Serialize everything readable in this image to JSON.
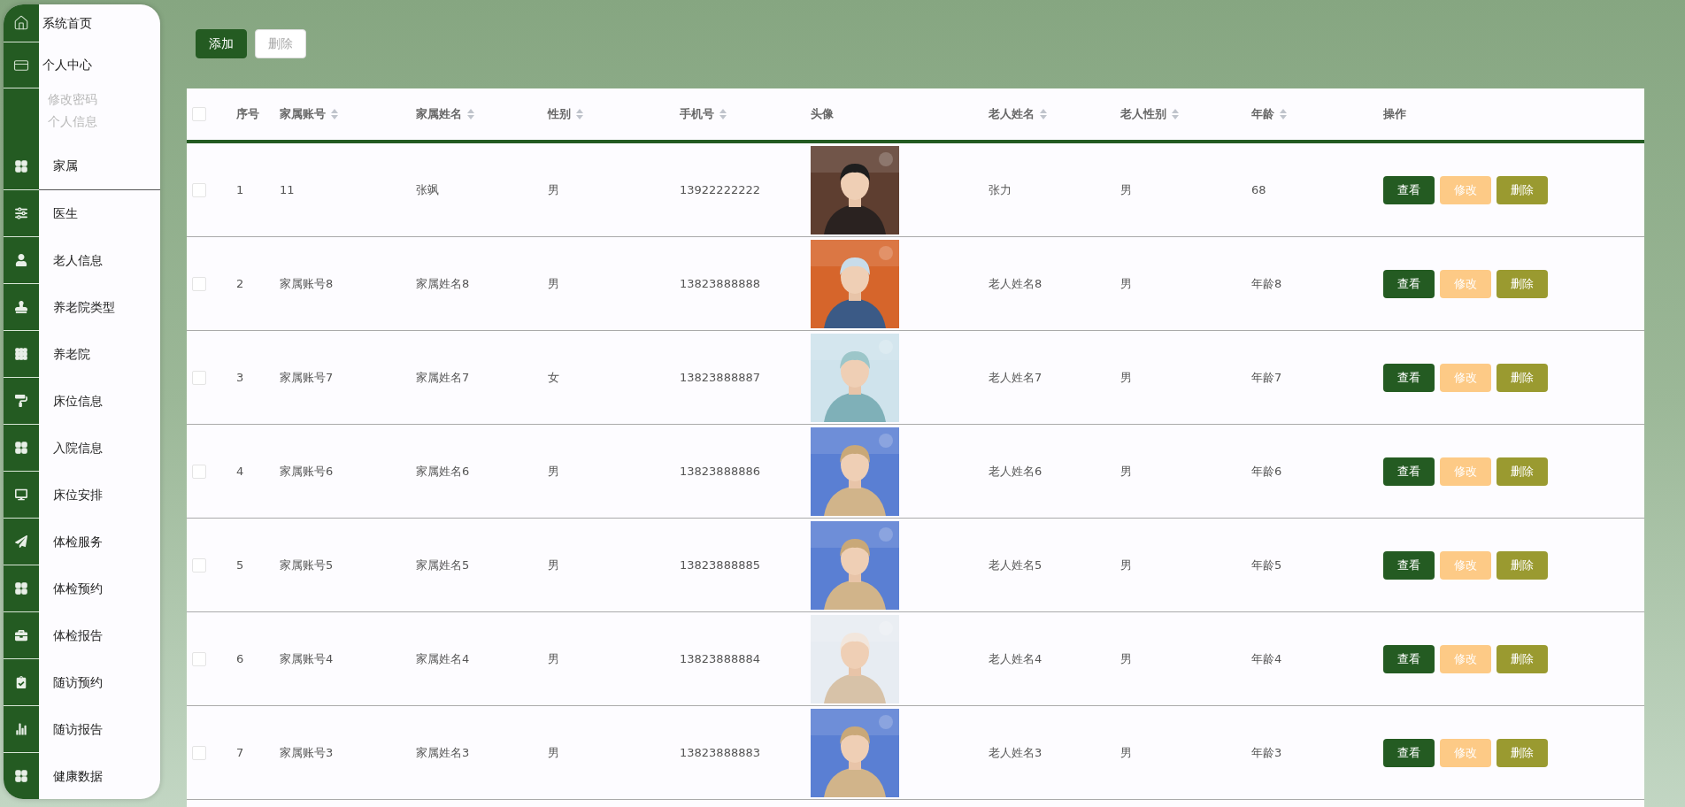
{
  "sidebar": {
    "items": [
      {
        "label": "系统首页",
        "selected": false
      },
      {
        "label": "个人中心",
        "selected": false,
        "expanded": true,
        "children": [
          {
            "label": "修改密码"
          },
          {
            "label": "个人信息"
          }
        ]
      },
      {
        "label": "家属",
        "selected": true
      },
      {
        "label": "医生",
        "selected": false
      },
      {
        "label": "老人信息",
        "selected": false
      },
      {
        "label": "养老院类型",
        "selected": false
      },
      {
        "label": "养老院",
        "selected": false
      },
      {
        "label": "床位信息",
        "selected": false
      },
      {
        "label": "入院信息",
        "selected": false
      },
      {
        "label": "床位安排",
        "selected": false
      },
      {
        "label": "体检服务",
        "selected": false
      },
      {
        "label": "体检预约",
        "selected": false
      },
      {
        "label": "体检报告",
        "selected": false
      },
      {
        "label": "随访预约",
        "selected": false
      },
      {
        "label": "随访报告",
        "selected": false
      },
      {
        "label": "健康数据",
        "selected": false
      }
    ]
  },
  "toolbar": [
    {
      "label": "添加",
      "disabled": false
    },
    {
      "label": "删除",
      "disabled": true
    }
  ],
  "table": {
    "select_all": {
      "checked": false
    },
    "columns": [
      {
        "label": "序号",
        "sortable": false
      },
      {
        "label": "家属账号",
        "sortable": true
      },
      {
        "label": "家属姓名",
        "sortable": true
      },
      {
        "label": "性别",
        "sortable": true
      },
      {
        "label": "手机号",
        "sortable": true
      },
      {
        "label": "头像",
        "sortable": false
      },
      {
        "label": "老人姓名",
        "sortable": true
      },
      {
        "label": "老人性别",
        "sortable": true
      },
      {
        "label": "年龄",
        "sortable": true
      },
      {
        "label": "操作",
        "sortable": false
      }
    ],
    "rows": [
      {
        "checked": false,
        "cells": [
          "1",
          "11",
          "张飒",
          "男",
          "13922222222",
          {
            "kind": "picture"
          },
          "张力",
          "男",
          "68"
        ],
        "actions": [
          {
            "label": "查看",
            "kind": "view"
          },
          {
            "label": "修改",
            "kind": "edit"
          },
          {
            "label": "删除",
            "kind": "delete"
          }
        ]
      },
      {
        "checked": false,
        "cells": [
          "2",
          "家属账号8",
          "家属姓名8",
          "男",
          "13823888888",
          {
            "kind": "picture"
          },
          "老人姓名8",
          "男",
          "年龄8"
        ],
        "actions": [
          {
            "label": "查看",
            "kind": "view"
          },
          {
            "label": "修改",
            "kind": "edit"
          },
          {
            "label": "删除",
            "kind": "delete"
          }
        ]
      },
      {
        "checked": false,
        "cells": [
          "3",
          "家属账号7",
          "家属姓名7",
          "女",
          "13823888887",
          {
            "kind": "picture"
          },
          "老人姓名7",
          "男",
          "年龄7"
        ],
        "actions": [
          {
            "label": "查看",
            "kind": "view"
          },
          {
            "label": "修改",
            "kind": "edit"
          },
          {
            "label": "删除",
            "kind": "delete"
          }
        ]
      },
      {
        "checked": false,
        "cells": [
          "4",
          "家属账号6",
          "家属姓名6",
          "男",
          "13823888886",
          {
            "kind": "picture"
          },
          "老人姓名6",
          "男",
          "年龄6"
        ],
        "actions": [
          {
            "label": "查看",
            "kind": "view"
          },
          {
            "label": "修改",
            "kind": "edit"
          },
          {
            "label": "删除",
            "kind": "delete"
          }
        ]
      },
      {
        "checked": false,
        "cells": [
          "5",
          "家属账号5",
          "家属姓名5",
          "男",
          "13823888885",
          {
            "kind": "picture"
          },
          "老人姓名5",
          "男",
          "年龄5"
        ],
        "actions": [
          {
            "label": "查看",
            "kind": "view"
          },
          {
            "label": "修改",
            "kind": "edit"
          },
          {
            "label": "删除",
            "kind": "delete"
          }
        ]
      },
      {
        "checked": false,
        "cells": [
          "6",
          "家属账号4",
          "家属姓名4",
          "男",
          "13823888884",
          {
            "kind": "picture"
          },
          "老人姓名4",
          "男",
          "年龄4"
        ],
        "actions": [
          {
            "label": "查看",
            "kind": "view"
          },
          {
            "label": "修改",
            "kind": "edit"
          },
          {
            "label": "删除",
            "kind": "delete"
          }
        ]
      },
      {
        "checked": false,
        "cells": [
          "7",
          "家属账号3",
          "家属姓名3",
          "男",
          "13823888883",
          {
            "kind": "picture"
          },
          "老人姓名3",
          "男",
          "年龄3"
        ],
        "actions": [
          {
            "label": "查看",
            "kind": "view"
          },
          {
            "label": "修改",
            "kind": "edit"
          },
          {
            "label": "删除",
            "kind": "delete"
          }
        ]
      }
    ]
  }
}
